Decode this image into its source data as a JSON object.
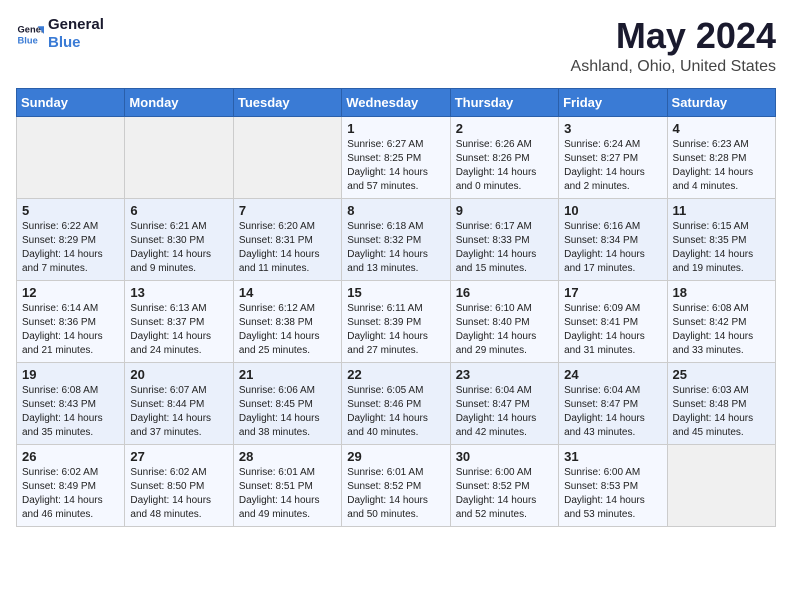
{
  "header": {
    "logo_line1": "General",
    "logo_line2": "Blue",
    "month": "May 2024",
    "location": "Ashland, Ohio, United States"
  },
  "days_of_week": [
    "Sunday",
    "Monday",
    "Tuesday",
    "Wednesday",
    "Thursday",
    "Friday",
    "Saturday"
  ],
  "weeks": [
    [
      {
        "day": "",
        "sunrise": "",
        "sunset": "",
        "daylight": ""
      },
      {
        "day": "",
        "sunrise": "",
        "sunset": "",
        "daylight": ""
      },
      {
        "day": "",
        "sunrise": "",
        "sunset": "",
        "daylight": ""
      },
      {
        "day": "1",
        "sunrise": "Sunrise: 6:27 AM",
        "sunset": "Sunset: 8:25 PM",
        "daylight": "Daylight: 14 hours and 57 minutes."
      },
      {
        "day": "2",
        "sunrise": "Sunrise: 6:26 AM",
        "sunset": "Sunset: 8:26 PM",
        "daylight": "Daylight: 14 hours and 0 minutes."
      },
      {
        "day": "3",
        "sunrise": "Sunrise: 6:24 AM",
        "sunset": "Sunset: 8:27 PM",
        "daylight": "Daylight: 14 hours and 2 minutes."
      },
      {
        "day": "4",
        "sunrise": "Sunrise: 6:23 AM",
        "sunset": "Sunset: 8:28 PM",
        "daylight": "Daylight: 14 hours and 4 minutes."
      }
    ],
    [
      {
        "day": "5",
        "sunrise": "Sunrise: 6:22 AM",
        "sunset": "Sunset: 8:29 PM",
        "daylight": "Daylight: 14 hours and 7 minutes."
      },
      {
        "day": "6",
        "sunrise": "Sunrise: 6:21 AM",
        "sunset": "Sunset: 8:30 PM",
        "daylight": "Daylight: 14 hours and 9 minutes."
      },
      {
        "day": "7",
        "sunrise": "Sunrise: 6:20 AM",
        "sunset": "Sunset: 8:31 PM",
        "daylight": "Daylight: 14 hours and 11 minutes."
      },
      {
        "day": "8",
        "sunrise": "Sunrise: 6:18 AM",
        "sunset": "Sunset: 8:32 PM",
        "daylight": "Daylight: 14 hours and 13 minutes."
      },
      {
        "day": "9",
        "sunrise": "Sunrise: 6:17 AM",
        "sunset": "Sunset: 8:33 PM",
        "daylight": "Daylight: 14 hours and 15 minutes."
      },
      {
        "day": "10",
        "sunrise": "Sunrise: 6:16 AM",
        "sunset": "Sunset: 8:34 PM",
        "daylight": "Daylight: 14 hours and 17 minutes."
      },
      {
        "day": "11",
        "sunrise": "Sunrise: 6:15 AM",
        "sunset": "Sunset: 8:35 PM",
        "daylight": "Daylight: 14 hours and 19 minutes."
      }
    ],
    [
      {
        "day": "12",
        "sunrise": "Sunrise: 6:14 AM",
        "sunset": "Sunset: 8:36 PM",
        "daylight": "Daylight: 14 hours and 21 minutes."
      },
      {
        "day": "13",
        "sunrise": "Sunrise: 6:13 AM",
        "sunset": "Sunset: 8:37 PM",
        "daylight": "Daylight: 14 hours and 24 minutes."
      },
      {
        "day": "14",
        "sunrise": "Sunrise: 6:12 AM",
        "sunset": "Sunset: 8:38 PM",
        "daylight": "Daylight: 14 hours and 25 minutes."
      },
      {
        "day": "15",
        "sunrise": "Sunrise: 6:11 AM",
        "sunset": "Sunset: 8:39 PM",
        "daylight": "Daylight: 14 hours and 27 minutes."
      },
      {
        "day": "16",
        "sunrise": "Sunrise: 6:10 AM",
        "sunset": "Sunset: 8:40 PM",
        "daylight": "Daylight: 14 hours and 29 minutes."
      },
      {
        "day": "17",
        "sunrise": "Sunrise: 6:09 AM",
        "sunset": "Sunset: 8:41 PM",
        "daylight": "Daylight: 14 hours and 31 minutes."
      },
      {
        "day": "18",
        "sunrise": "Sunrise: 6:08 AM",
        "sunset": "Sunset: 8:42 PM",
        "daylight": "Daylight: 14 hours and 33 minutes."
      }
    ],
    [
      {
        "day": "19",
        "sunrise": "Sunrise: 6:08 AM",
        "sunset": "Sunset: 8:43 PM",
        "daylight": "Daylight: 14 hours and 35 minutes."
      },
      {
        "day": "20",
        "sunrise": "Sunrise: 6:07 AM",
        "sunset": "Sunset: 8:44 PM",
        "daylight": "Daylight: 14 hours and 37 minutes."
      },
      {
        "day": "21",
        "sunrise": "Sunrise: 6:06 AM",
        "sunset": "Sunset: 8:45 PM",
        "daylight": "Daylight: 14 hours and 38 minutes."
      },
      {
        "day": "22",
        "sunrise": "Sunrise: 6:05 AM",
        "sunset": "Sunset: 8:46 PM",
        "daylight": "Daylight: 14 hours and 40 minutes."
      },
      {
        "day": "23",
        "sunrise": "Sunrise: 6:04 AM",
        "sunset": "Sunset: 8:47 PM",
        "daylight": "Daylight: 14 hours and 42 minutes."
      },
      {
        "day": "24",
        "sunrise": "Sunrise: 6:04 AM",
        "sunset": "Sunset: 8:47 PM",
        "daylight": "Daylight: 14 hours and 43 minutes."
      },
      {
        "day": "25",
        "sunrise": "Sunrise: 6:03 AM",
        "sunset": "Sunset: 8:48 PM",
        "daylight": "Daylight: 14 hours and 45 minutes."
      }
    ],
    [
      {
        "day": "26",
        "sunrise": "Sunrise: 6:02 AM",
        "sunset": "Sunset: 8:49 PM",
        "daylight": "Daylight: 14 hours and 46 minutes."
      },
      {
        "day": "27",
        "sunrise": "Sunrise: 6:02 AM",
        "sunset": "Sunset: 8:50 PM",
        "daylight": "Daylight: 14 hours and 48 minutes."
      },
      {
        "day": "28",
        "sunrise": "Sunrise: 6:01 AM",
        "sunset": "Sunset: 8:51 PM",
        "daylight": "Daylight: 14 hours and 49 minutes."
      },
      {
        "day": "29",
        "sunrise": "Sunrise: 6:01 AM",
        "sunset": "Sunset: 8:52 PM",
        "daylight": "Daylight: 14 hours and 50 minutes."
      },
      {
        "day": "30",
        "sunrise": "Sunrise: 6:00 AM",
        "sunset": "Sunset: 8:52 PM",
        "daylight": "Daylight: 14 hours and 52 minutes."
      },
      {
        "day": "31",
        "sunrise": "Sunrise: 6:00 AM",
        "sunset": "Sunset: 8:53 PM",
        "daylight": "Daylight: 14 hours and 53 minutes."
      },
      {
        "day": "",
        "sunrise": "",
        "sunset": "",
        "daylight": ""
      }
    ]
  ]
}
